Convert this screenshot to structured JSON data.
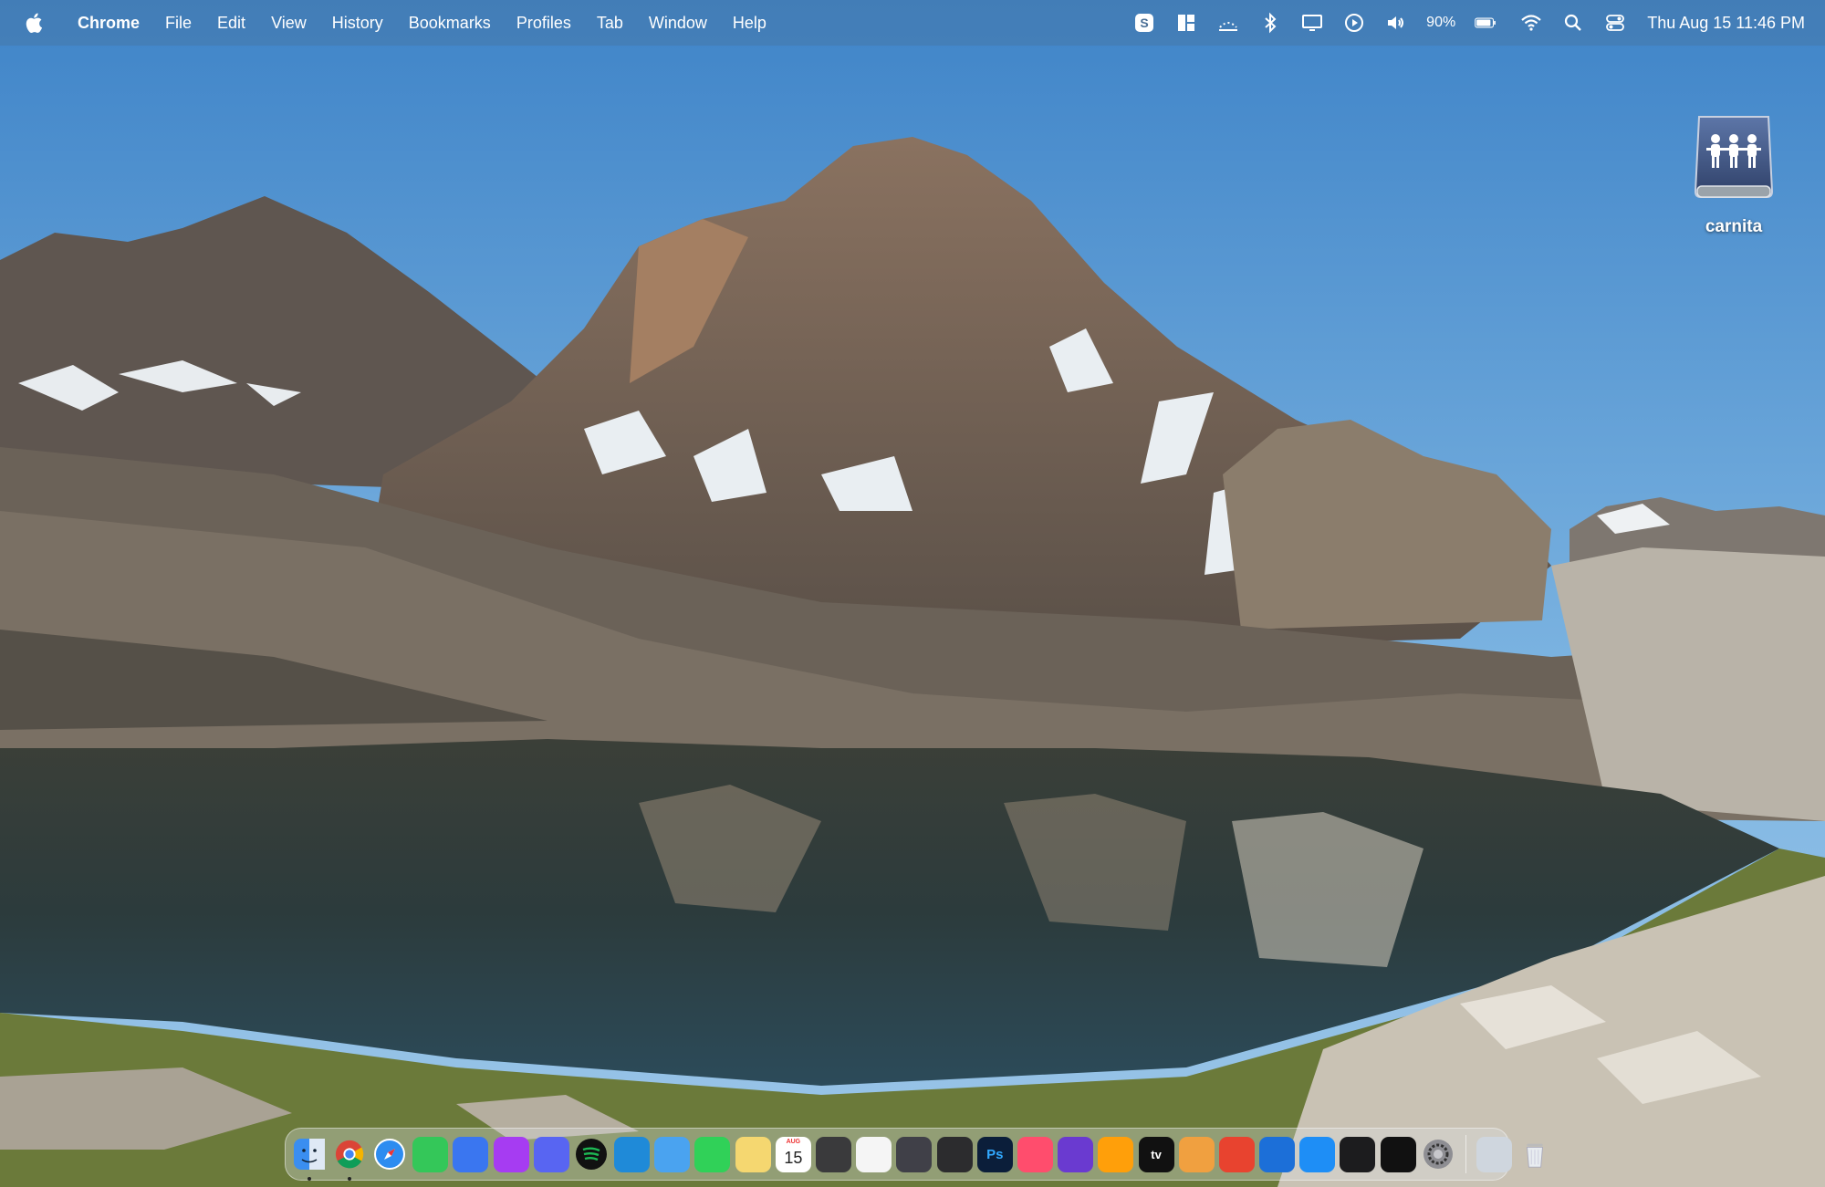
{
  "menubar": {
    "apple_icon": "apple-logo-icon",
    "app_name": "Chrome",
    "menus": [
      "File",
      "Edit",
      "View",
      "History",
      "Bookmarks",
      "Profiles",
      "Tab",
      "Window",
      "Help"
    ],
    "status_icons": [
      "skype-icon",
      "window-layout-icon",
      "weather-icon",
      "bluetooth-icon",
      "display-icon",
      "play-icon",
      "volume-icon"
    ],
    "battery_percent": "90%",
    "battery_level": 0.9,
    "extra_icons": [
      "wifi-icon",
      "search-icon",
      "control-center-icon"
    ],
    "clock": "Thu Aug 15  11:46 PM"
  },
  "desktop": {
    "drive_label": "carnita",
    "drive_icon": "network-share-drive-icon"
  },
  "dock": {
    "apps": [
      {
        "name": "finder",
        "color": "#3a8ef0",
        "running": true
      },
      {
        "name": "chrome",
        "color": "#f2f2f2",
        "running": true
      },
      {
        "name": "safari",
        "color": "#2d8cf0",
        "running": false
      },
      {
        "name": "messages",
        "color": "#34c759",
        "running": false
      },
      {
        "name": "signal",
        "color": "#3a76f0",
        "running": false
      },
      {
        "name": "messenger",
        "color": "#a63cf2",
        "running": false
      },
      {
        "name": "discord",
        "color": "#5865f2",
        "running": false
      },
      {
        "name": "spotify",
        "color": "#1db954",
        "running": false
      },
      {
        "name": "vscode",
        "color": "#1f8ad8",
        "running": false
      },
      {
        "name": "mail",
        "color": "#4aa3f0",
        "running": false
      },
      {
        "name": "facetime",
        "color": "#30d158",
        "running": false
      },
      {
        "name": "notes",
        "color": "#f5d770",
        "running": false
      },
      {
        "name": "calendar",
        "color": "#ffffff",
        "running": false
      },
      {
        "name": "keyboard-viewer",
        "color": "#3a3a3c",
        "running": false
      },
      {
        "name": "vivaldi",
        "color": "#f5f5f5",
        "running": false
      },
      {
        "name": "chess",
        "color": "#404048",
        "running": false
      },
      {
        "name": "final-cut",
        "color": "#2c2c2e",
        "running": false
      },
      {
        "name": "photoshop",
        "color": "#0b1e3a",
        "running": false
      },
      {
        "name": "creative-cloud",
        "color": "#ff4d6d",
        "running": false
      },
      {
        "name": "audio-app",
        "color": "#6a3ad0",
        "running": false
      },
      {
        "name": "pages",
        "color": "#ff9f0a",
        "running": false
      },
      {
        "name": "apple-tv",
        "color": "#111111",
        "running": false
      },
      {
        "name": "photos",
        "color": "#f0a040",
        "running": false
      },
      {
        "name": "red-app",
        "color": "#e8432f",
        "running": false
      },
      {
        "name": "xcode-editor",
        "color": "#1c6fd8",
        "running": false
      },
      {
        "name": "app-store",
        "color": "#1e8ef6",
        "running": false
      },
      {
        "name": "activity-monitor",
        "color": "#1c1c1e",
        "running": false
      },
      {
        "name": "terminal",
        "color": "#111111",
        "running": false
      },
      {
        "name": "system-settings",
        "color": "#8e8e93",
        "running": false
      }
    ],
    "ps_label": "Ps",
    "calendar_day": "15",
    "calendar_month": "AUG",
    "tv_label": "tv",
    "trailing": [
      {
        "name": "downloads-stack",
        "color": "#cfd6de"
      },
      {
        "name": "trash",
        "color": "#e0e4ea"
      }
    ]
  }
}
